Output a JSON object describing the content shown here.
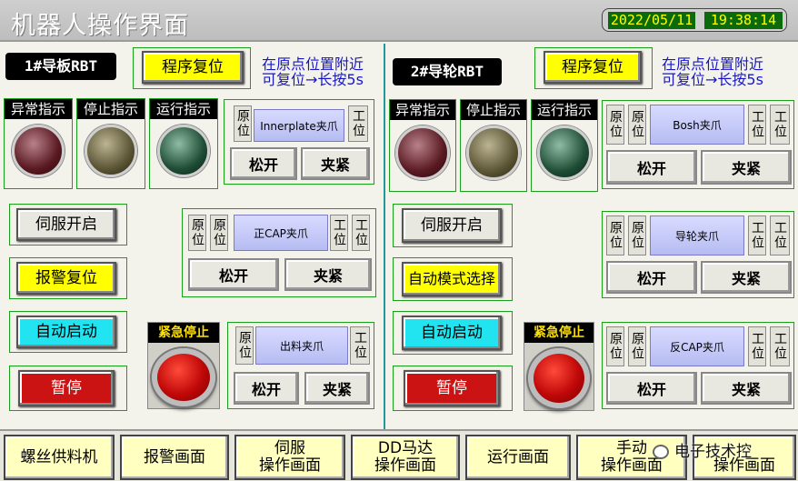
{
  "title": "机器人操作界面",
  "date": "2022/05/11",
  "time": "19:38:14",
  "left": {
    "robot_label": "1#导板RBT",
    "reset_button": "程序复位",
    "reset_note_line1": "在原点位置附近",
    "reset_note_line2": "可复位→长按5s",
    "indicators": [
      "异常指示",
      "停止指示",
      "运行指示"
    ],
    "servo_on": "伺服开启",
    "alarm_reset": "报警复位",
    "auto_start": "自动启动",
    "pause": "暂停",
    "estop_label": "紧急停止",
    "gripper1": {
      "origin": "原位",
      "name": "Innerplate夹爪",
      "work": "工位",
      "open": "松开",
      "clamp": "夹紧"
    },
    "gripper2": {
      "origin": "原位",
      "origin2": "原位",
      "name": "正CAP夹爪",
      "work": "工位",
      "work2": "工位",
      "open": "松开",
      "clamp": "夹紧"
    },
    "gripper3": {
      "origin": "原位",
      "name": "出料夹爪",
      "work": "工位",
      "open": "松开",
      "clamp": "夹紧"
    }
  },
  "right": {
    "robot_label": "2#导轮RBT",
    "reset_button": "程序复位",
    "reset_note_line1": "在原点位置附近",
    "reset_note_line2": "可复位→长按5s",
    "indicators": [
      "异常指示",
      "停止指示",
      "运行指示"
    ],
    "servo_on": "伺服开启",
    "auto_mode": "自动模式选择",
    "auto_start": "自动启动",
    "pause": "暂停",
    "estop_label": "紧急停止",
    "gripper1": {
      "origin": "原位",
      "origin2": "原位",
      "name": "Bosh夹爪",
      "work": "工位",
      "work2": "工位",
      "open": "松开",
      "clamp": "夹紧"
    },
    "gripper2": {
      "origin": "原位",
      "origin2": "原位",
      "name": "导轮夹爪",
      "work": "工位",
      "work2": "工位",
      "open": "松开",
      "clamp": "夹紧"
    },
    "gripper3": {
      "origin": "原位",
      "origin2": "原位",
      "name": "反CAP夹爪",
      "work": "工位",
      "work2": "工位",
      "open": "松开",
      "clamp": "夹紧"
    }
  },
  "nav": [
    {
      "line1": "螺丝供料机",
      "line2": ""
    },
    {
      "line1": "报警画面",
      "line2": ""
    },
    {
      "line1": "伺服",
      "line2": "操作画面"
    },
    {
      "line1": "DD马达",
      "line2": "操作画面"
    },
    {
      "line1": "运行画面",
      "line2": ""
    },
    {
      "line1": "手动",
      "line2": "操作画面"
    },
    {
      "line1": "",
      "line2": "操作画面"
    }
  ],
  "watermark": "电子技术控",
  "colors": {
    "lamp_alarm": "#5a1a22",
    "lamp_stop": "#5c5636",
    "lamp_run": "#1f4d36",
    "accent_yellow": "#ffff00",
    "accent_cyan": "#22e4f0",
    "accent_red": "#cc1313"
  }
}
